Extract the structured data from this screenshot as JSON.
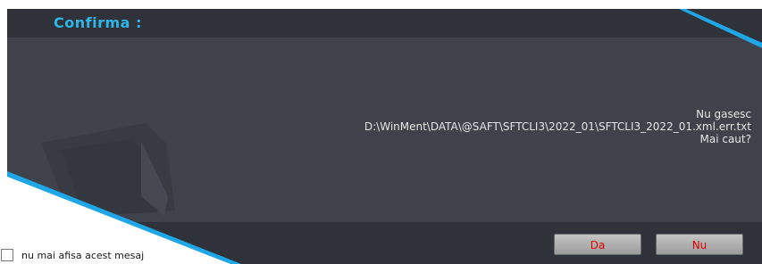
{
  "dialog": {
    "title": "Confirma :",
    "message": {
      "line1": "Nu gasesc",
      "line2": "D:\\WinMent\\DATA\\@SAFT\\SFTCLI3\\2022_01\\SFTCLI3_2022_01.xml.err.txt",
      "line3": "Mai caut?"
    },
    "buttons": {
      "yes_label": "Da",
      "no_label": "Nu"
    },
    "dont_show_label": "nu mai afisa acest mesaj",
    "dont_show_checked": false
  },
  "colors": {
    "title": "#2fb6e8",
    "accent_stripe": "#1ea6e6",
    "button_text": "#e00000"
  },
  "icons": [
    "folder-watermark-icon"
  ]
}
